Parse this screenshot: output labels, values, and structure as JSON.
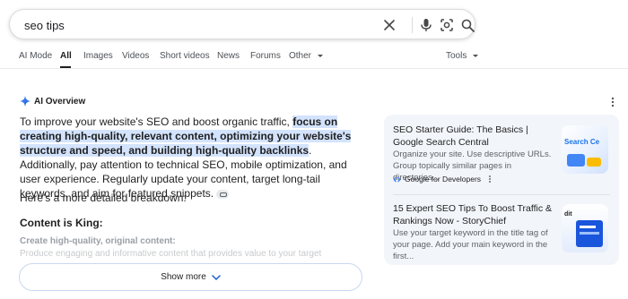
{
  "search": {
    "query": "seo tips"
  },
  "tabs": [
    {
      "label": "AI Mode"
    },
    {
      "label": "All"
    },
    {
      "label": "Images"
    },
    {
      "label": "Videos"
    },
    {
      "label": "Short videos"
    },
    {
      "label": "News"
    },
    {
      "label": "Forums"
    },
    {
      "label": "Other"
    }
  ],
  "tools_label": "Tools",
  "ai_overview": {
    "label": "AI Overview",
    "intro_plain": "To improve your website's SEO and boost organic traffic, ",
    "intro_highlight": "focus on creating high-quality, relevant content, optimizing your website's structure and speed, and building high-quality backlinks",
    "intro_rest": ". Additionally, pay attention to technical SEO, mobile optimization, and user experience. Regularly update your content, target long-tail keywords, and aim for featured snippets.",
    "breakdown": "Here's a more detailed breakdown:",
    "heading": "Content is King:",
    "subheading": "Create high-quality, original content:",
    "faded_line": "Produce engaging and informative content that provides value to your target",
    "show_more": "Show more"
  },
  "sources": [
    {
      "title": "SEO Starter Guide: The Basics | Google Search Central",
      "snippet": "Organize your site. Use descriptive URLs. Group topically similar pages in directories...",
      "source_name": "Google for Developers",
      "thumb_text": "Search Ce"
    },
    {
      "title": "15 Expert SEO Tips To Boost Traffic & Rankings Now - StoryChief",
      "snippet": "Use your target keyword in the title tag of your page. Add your main keyword in the first...",
      "thumb_text": "dit"
    }
  ],
  "colors": {
    "highlight": "#d3e3fd",
    "panel_bg": "#f2f5fa",
    "border": "#dadce0"
  }
}
